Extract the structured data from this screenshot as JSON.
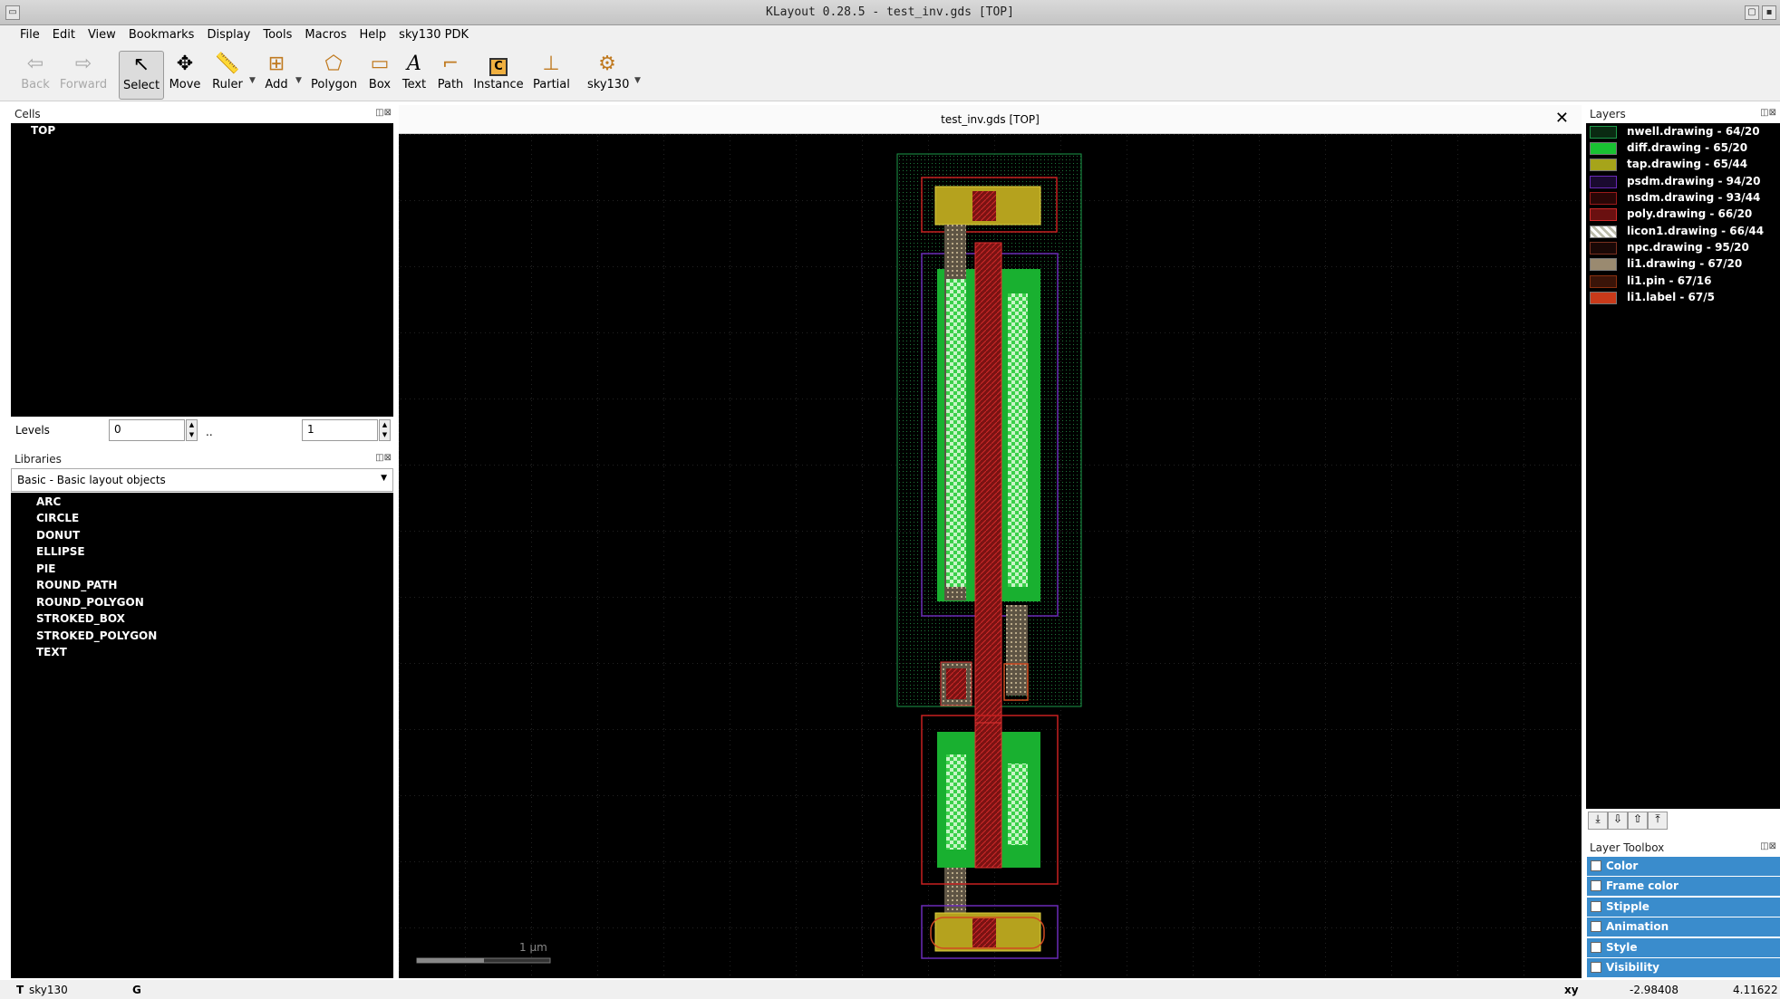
{
  "window": {
    "title": "KLayout 0.28.5 - test_inv.gds [TOP]"
  },
  "menu": [
    "File",
    "Edit",
    "View",
    "Bookmarks",
    "Display",
    "Tools",
    "Macros",
    "Help",
    "sky130 PDK"
  ],
  "toolbar": {
    "back": "Back",
    "forward": "Forward",
    "select": "Select",
    "move": "Move",
    "ruler": "Ruler",
    "add": "Add",
    "polygon": "Polygon",
    "box": "Box",
    "text": "Text",
    "path": "Path",
    "instance": "Instance",
    "partial": "Partial",
    "sky130": "sky130"
  },
  "cells": {
    "title": "Cells",
    "items": [
      "TOP"
    ]
  },
  "levels": {
    "label": "Levels",
    "from": "0",
    "to": "1",
    "sep": ".."
  },
  "libraries": {
    "title": "Libraries",
    "selected": "Basic - Basic layout objects",
    "items": [
      "ARC",
      "CIRCLE",
      "DONUT",
      "ELLIPSE",
      "PIE",
      "ROUND_PATH",
      "ROUND_POLYGON",
      "STROKED_BOX",
      "STROKED_POLYGON",
      "TEXT"
    ]
  },
  "view": {
    "tab_title": "test_inv.gds [TOP]",
    "scale_label": "1 μm"
  },
  "layers": {
    "title": "Layers",
    "items": [
      {
        "name": "nwell.drawing - 64/20",
        "color": "#1d7a3a"
      },
      {
        "name": "diff.drawing - 65/20",
        "color": "#19c232"
      },
      {
        "name": "tap.drawing - 65/44",
        "color": "#a6a41a"
      },
      {
        "name": "psdm.drawing - 94/20",
        "color": "#4b1a8c"
      },
      {
        "name": "nsdm.drawing - 93/44",
        "color": "#6d1010"
      },
      {
        "name": "poly.drawing - 66/20",
        "color": "#b81d1d"
      },
      {
        "name": "licon1.drawing - 66/44",
        "color": "#e8e0c0"
      },
      {
        "name": "npc.drawing - 95/20",
        "color": "#2a0e0a"
      },
      {
        "name": "li1.drawing - 67/20",
        "color": "#9a8a70"
      },
      {
        "name": "li1.pin - 67/16",
        "color": "#5a2010"
      },
      {
        "name": "li1.label - 67/5",
        "color": "#c83a1a"
      }
    ]
  },
  "layer_toolbox": {
    "title": "Layer Toolbox",
    "items": [
      "Color",
      "Frame color",
      "Stipple",
      "Animation",
      "Style",
      "Visibility"
    ]
  },
  "status": {
    "tech_prefix": "T",
    "tech": "sky130",
    "mode": "G",
    "coord_label": "xy",
    "x": "-2.98408",
    "y": "4.11622"
  }
}
